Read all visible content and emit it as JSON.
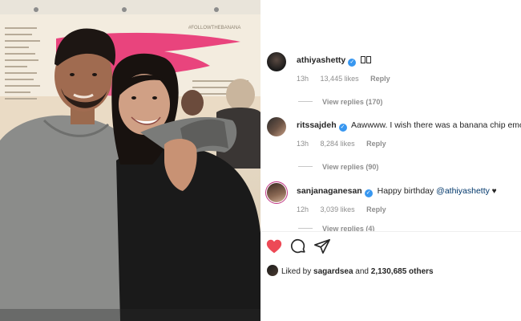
{
  "post": {
    "image_alt": "couple photo",
    "wall_text": "#FOLLOWTHEBANANA"
  },
  "comments": [
    {
      "username": "athiyashetty",
      "verified": true,
      "text": "",
      "emoji_count": 2,
      "time": "13h",
      "likes": "13,445 likes",
      "reply_label": "Reply",
      "view_replies": "View replies (170)"
    },
    {
      "username": "ritssajdeh",
      "verified": true,
      "text": "Aawwww. I wish there was a banana chip emoji",
      "time": "13h",
      "likes": "8,284 likes",
      "reply_label": "Reply",
      "view_replies": "View replies (90)"
    },
    {
      "username": "sanjanaganesan",
      "verified": true,
      "text_prefix": "Happy birthday ",
      "mention": "@athiyashetty",
      "text_suffix": " ♥",
      "time": "12h",
      "likes": "3,039 likes",
      "reply_label": "Reply",
      "view_replies": "View replies (4)"
    }
  ],
  "actions": {
    "like_icon": "heart-filled-icon",
    "comment_icon": "comment-bubble-icon",
    "share_icon": "paper-plane-icon",
    "like_color": "#ed4956"
  },
  "liked_by": {
    "prefix": "Liked by ",
    "user": "sagardsea",
    "middle": " and ",
    "others": "2,130,685 others"
  }
}
